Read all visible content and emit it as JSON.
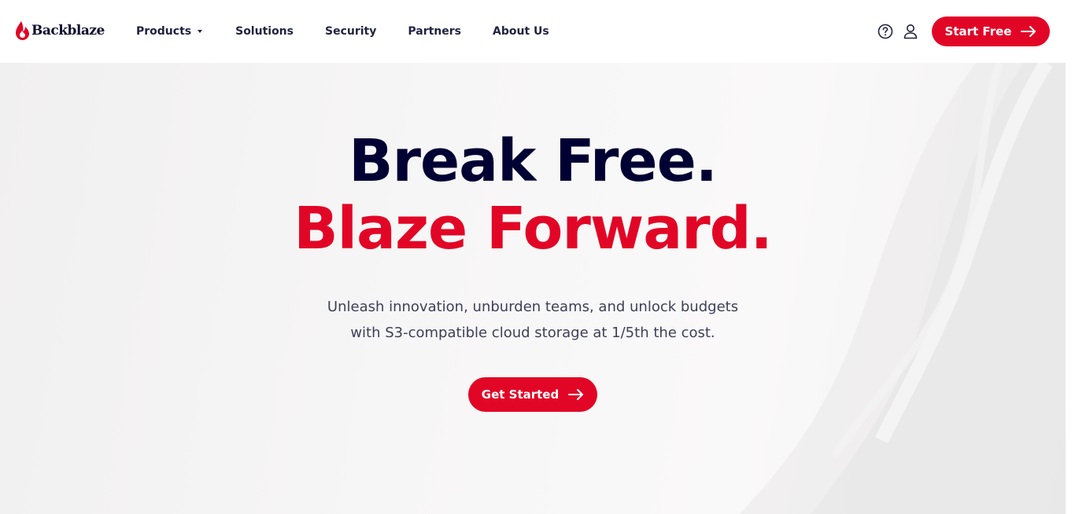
{
  "brand": {
    "name": "Backblaze",
    "accent_color": "#e20626",
    "navy_color": "#000033"
  },
  "nav": {
    "items": [
      {
        "label": "Products",
        "has_dropdown": true
      },
      {
        "label": "Solutions"
      },
      {
        "label": "Security"
      },
      {
        "label": "Partners"
      },
      {
        "label": "About Us"
      }
    ]
  },
  "header_actions": {
    "help_icon": "question-circle-icon",
    "account_icon": "user-icon",
    "cta_label": "Start Free",
    "cta_icon": "arrow-right-icon"
  },
  "hero": {
    "headline_line1": "Break Free.",
    "headline_line2": "Blaze Forward.",
    "subtext_line1": "Unleash innovation, unburden teams, and unlock budgets",
    "subtext_line2": "with S3-compatible cloud storage at 1/5th the cost.",
    "cta_label": "Get Started",
    "cta_icon": "arrow-right-icon"
  }
}
